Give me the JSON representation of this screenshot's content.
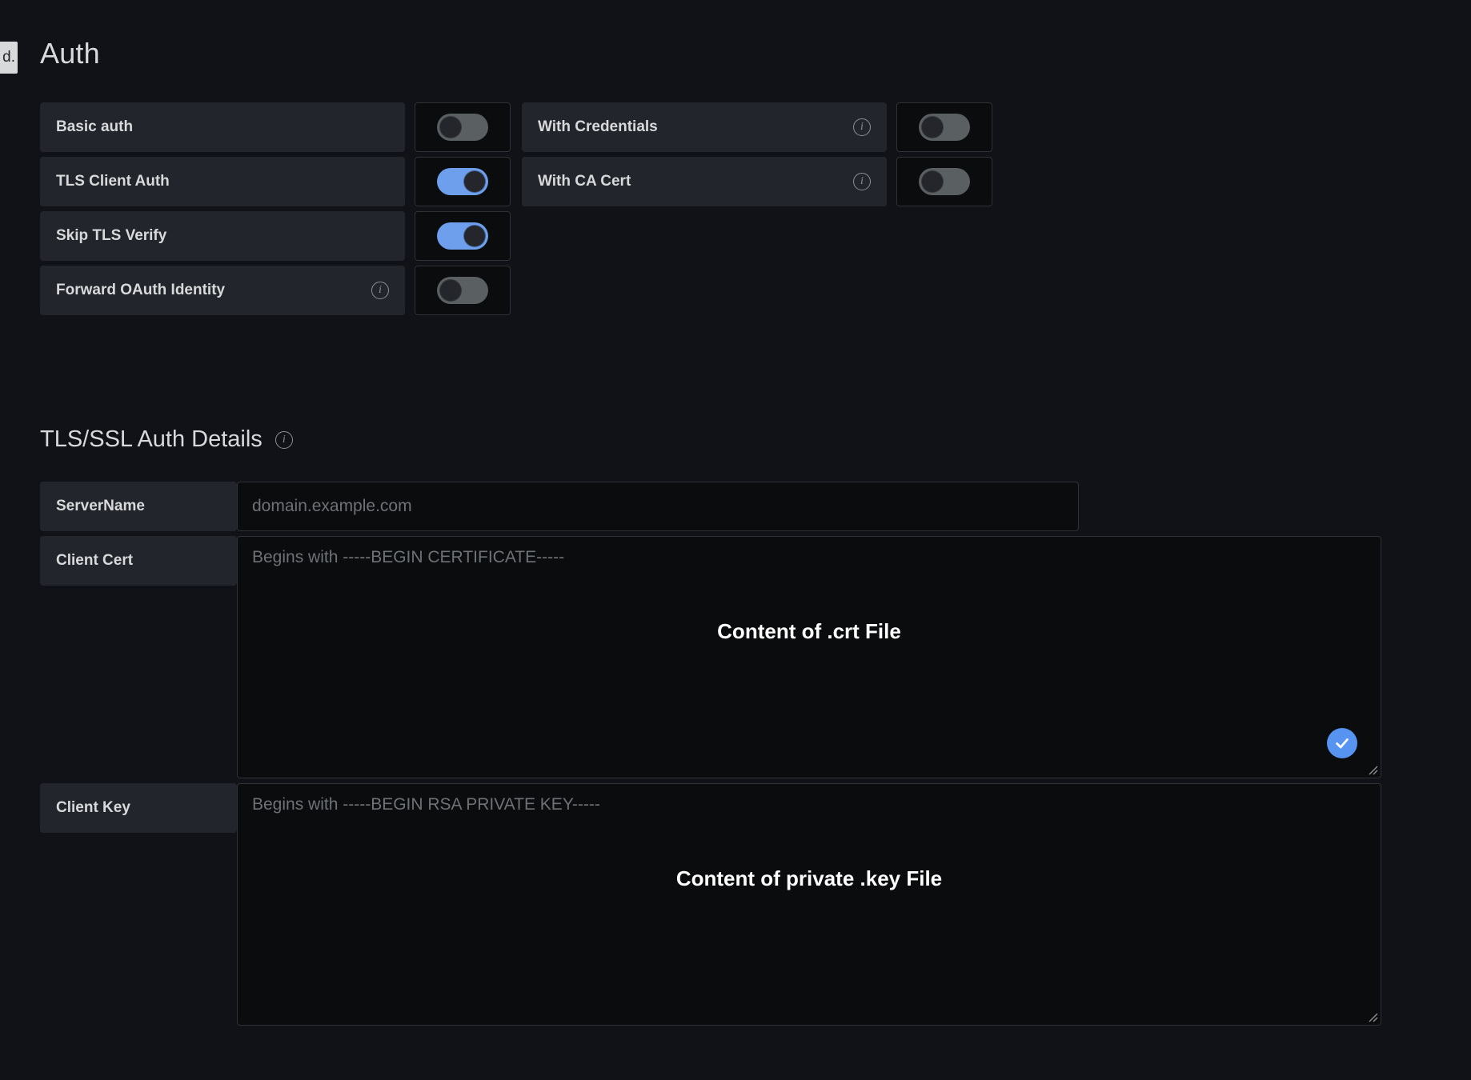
{
  "tooltip_fragment": {
    "text": "d."
  },
  "header": {
    "title": "Auth"
  },
  "auth_toggles": {
    "rows": [
      {
        "left": {
          "label": "Basic auth",
          "has_info": false,
          "toggle_state": "off",
          "toggle_name": "basic-auth-toggle"
        },
        "right": {
          "label": "With Credentials",
          "has_info": true,
          "toggle_state": "off",
          "toggle_name": "with-credentials-toggle"
        }
      },
      {
        "left": {
          "label": "TLS Client Auth",
          "has_info": false,
          "toggle_state": "on",
          "toggle_name": "tls-client-auth-toggle"
        },
        "right": {
          "label": "With CA Cert",
          "has_info": true,
          "toggle_state": "off",
          "toggle_name": "with-ca-cert-toggle"
        }
      },
      {
        "left": {
          "label": "Skip TLS Verify",
          "has_info": false,
          "toggle_state": "on",
          "toggle_name": "skip-tls-verify-toggle"
        },
        "right": null
      },
      {
        "left": {
          "label": "Forward OAuth Identity",
          "has_info": true,
          "toggle_state": "off",
          "toggle_name": "forward-oauth-identity-toggle"
        },
        "right": null
      }
    ]
  },
  "tls_section": {
    "title": "TLS/SSL Auth Details",
    "has_info": true,
    "server_name": {
      "label": "ServerName",
      "value": "",
      "placeholder": "domain.example.com"
    },
    "client_cert": {
      "label": "Client Cert",
      "value": "",
      "placeholder": "Begins with -----BEGIN CERTIFICATE-----",
      "overlay_text": "Content of .crt File",
      "has_check_button": true,
      "check_button_color": "#5794f2"
    },
    "client_key": {
      "label": "Client Key",
      "value": "",
      "placeholder": "Begins with -----BEGIN RSA PRIVATE KEY-----",
      "overlay_text": "Content of private .key File",
      "has_check_button": false
    }
  },
  "icons": {
    "info": "i",
    "check": "check-icon",
    "resize": "resize-handle-icon"
  },
  "colors": {
    "background": "#111217",
    "panel": "#22252b",
    "input_bg": "#0b0c0e",
    "border": "#2c3235",
    "text": "#d8d9da",
    "placeholder": "#6e7276",
    "toggle_on": "#6e9fec",
    "toggle_off": "#5a5f62",
    "accent_blue": "#5794f2"
  }
}
